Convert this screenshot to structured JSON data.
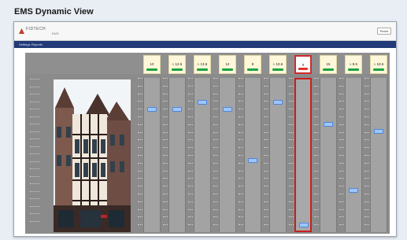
{
  "caption": "EMS Dynamic View",
  "window": {
    "logo_text": "FIDTECH",
    "logo_sub": "EMS",
    "top_button": "Reset"
  },
  "nav": {
    "settings": "Settings",
    "reports": "Reports"
  },
  "colors": {
    "tile_bg": "#fff7d9",
    "ok_bar": "#19a340",
    "alarm": "#d12b2b",
    "thumb": "#9ec6ff",
    "nav": "#233a78"
  },
  "channels": [
    {
      "value": "10",
      "status": "ok",
      "level": 0.2
    },
    {
      "value": "≈ 12.6",
      "status": "ok",
      "level": 0.2
    },
    {
      "value": "≈ 13.6",
      "status": "ok",
      "level": 0.15
    },
    {
      "value": "12",
      "status": "ok",
      "level": 0.2
    },
    {
      "value": "8",
      "status": "ok",
      "level": 0.55
    },
    {
      "value": "≈ 10.6",
      "status": "ok",
      "level": 0.15
    },
    {
      "value": "0",
      "status": "alarm",
      "level": 0.98
    },
    {
      "value": "15",
      "status": "ok",
      "level": 0.3
    },
    {
      "value": "≈ 8.6",
      "status": "ok",
      "level": 0.75
    },
    {
      "value": "≈ 18.6",
      "status": "ok",
      "level": 0.35
    }
  ]
}
